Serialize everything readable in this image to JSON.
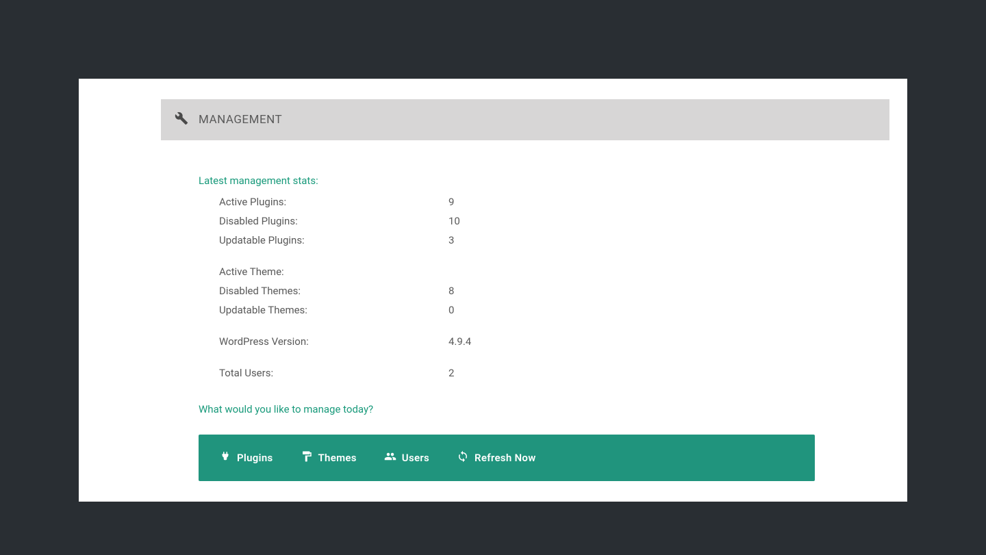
{
  "header": {
    "title": "MANAGEMENT"
  },
  "stats_heading": "Latest management stats:",
  "stats": {
    "active_plugins_label": "Active Plugins:",
    "active_plugins_value": "9",
    "disabled_plugins_label": "Disabled Plugins:",
    "disabled_plugins_value": "10",
    "updatable_plugins_label": "Updatable Plugins:",
    "updatable_plugins_value": "3",
    "active_theme_label": "Active Theme:",
    "active_theme_value": "",
    "disabled_themes_label": "Disabled Themes:",
    "disabled_themes_value": "8",
    "updatable_themes_label": "Updatable Themes:",
    "updatable_themes_value": "0",
    "wordpress_version_label": "WordPress Version:",
    "wordpress_version_value": "4.9.4",
    "total_users_label": "Total Users:",
    "total_users_value": "2"
  },
  "manage_prompt": "What would you like to manage today?",
  "actions": {
    "plugins": "Plugins",
    "themes": "Themes",
    "users": "Users",
    "refresh": "Refresh Now"
  }
}
